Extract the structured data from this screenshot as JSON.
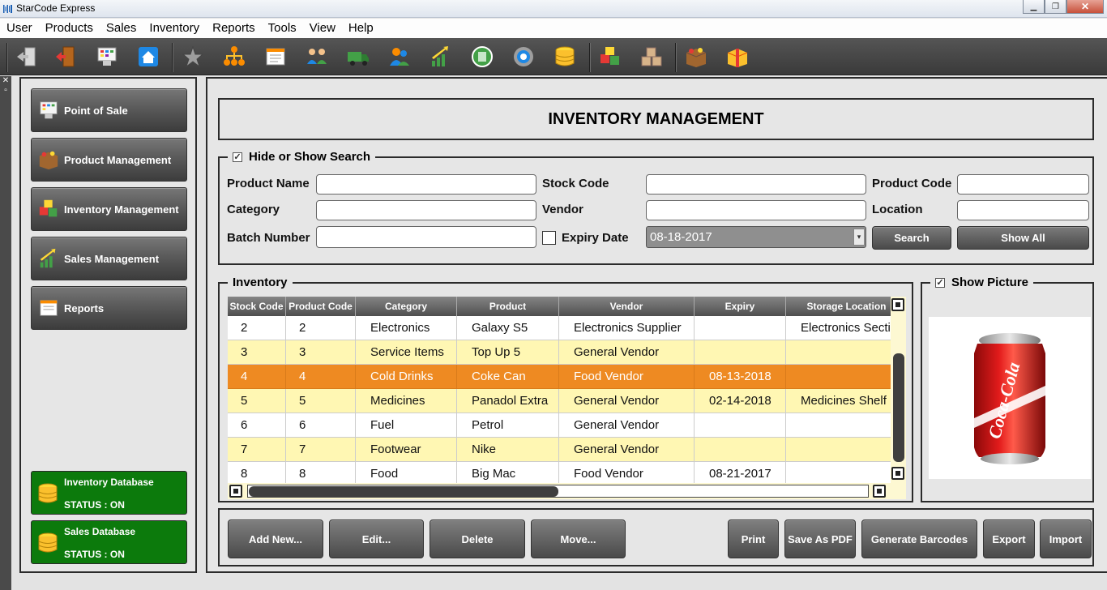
{
  "window": {
    "title": "StarCode Express",
    "minimize": "▁",
    "maximize": "❐",
    "close": "✕"
  },
  "menu": [
    "User",
    "Products",
    "Sales",
    "Inventory",
    "Reports",
    "Tools",
    "View",
    "Help"
  ],
  "toolbar": {
    "icons": [
      "logout-icon",
      "exit-door-icon",
      "pos-terminal-icon",
      "home-icon",
      "star-icon",
      "hierarchy-icon",
      "document-icon",
      "users-group-icon",
      "delivery-truck-icon",
      "customers-icon",
      "sales-chart-icon",
      "circle-app-icon",
      "settings-gear-icon",
      "database-icon",
      "inventory-boxes-icon",
      "stock-boxes-icon",
      "product-box-icon",
      "gift-box-icon"
    ]
  },
  "leftstrip": {
    "close": "✕",
    "restore": "▫"
  },
  "sidebar": {
    "items": [
      {
        "label": "Point of Sale",
        "icon": "pos-terminal-icon"
      },
      {
        "label": "Product Management",
        "icon": "product-box-icon"
      },
      {
        "label": "Inventory Management",
        "icon": "inventory-boxes-icon"
      },
      {
        "label": "Sales Management",
        "icon": "sales-chart-icon"
      },
      {
        "label": "Reports",
        "icon": "report-icon"
      }
    ],
    "databases": [
      {
        "name": "Inventory Database",
        "status": "STATUS : ON"
      },
      {
        "name": "Sales Database",
        "status": "STATUS : ON"
      }
    ]
  },
  "page": {
    "title": "INVENTORY MANAGEMENT"
  },
  "search": {
    "legend": "Hide or Show Search",
    "checked": "✓",
    "product_name_label": "Product Name",
    "stock_code_label": "Stock Code",
    "product_code_label": "Product Code",
    "category_label": "Category",
    "vendor_label": "Vendor",
    "location_label": "Location",
    "batch_number_label": "Batch Number",
    "expiry_date_label": "Expiry Date",
    "expiry_date_value": "08-18-2017",
    "dropdown_arrow": "▾",
    "search_button": "Search",
    "show_all_button": "Show All"
  },
  "inventory": {
    "legend": "Inventory",
    "columns": [
      "Stock Code",
      "Product Code",
      "Category",
      "Product",
      "Vendor",
      "Expiry",
      "Storage Location"
    ],
    "rows": [
      [
        "2",
        "2",
        "Electronics",
        "Galaxy S5",
        "Electronics Supplier",
        "",
        "Electronics Section"
      ],
      [
        "3",
        "3",
        "Service Items",
        "Top Up 5",
        "General Vendor",
        "",
        ""
      ],
      [
        "4",
        "4",
        "Cold Drinks",
        "Coke Can",
        "Food Vendor",
        "08-13-2018",
        ""
      ],
      [
        "5",
        "5",
        "Medicines",
        "Panadol Extra",
        "General Vendor",
        "02-14-2018",
        "Medicines Shelf B"
      ],
      [
        "6",
        "6",
        "Fuel",
        "Petrol",
        "General Vendor",
        "",
        ""
      ],
      [
        "7",
        "7",
        "Footwear",
        "Nike",
        "General Vendor",
        "",
        ""
      ],
      [
        "8",
        "8",
        "Food",
        "Big Mac",
        "Food Vendor",
        "08-21-2017",
        ""
      ]
    ],
    "selected_row": 2
  },
  "picture": {
    "legend": "Show Picture",
    "checked": "✓",
    "logo_text": "Coca-Cola"
  },
  "actions": {
    "add_new": "Add New...",
    "edit": "Edit...",
    "delete": "Delete",
    "move": "Move...",
    "print": "Print",
    "save_pdf": "Save As PDF",
    "barcodes": "Generate Barcodes",
    "export": "Export",
    "import": "Import"
  }
}
